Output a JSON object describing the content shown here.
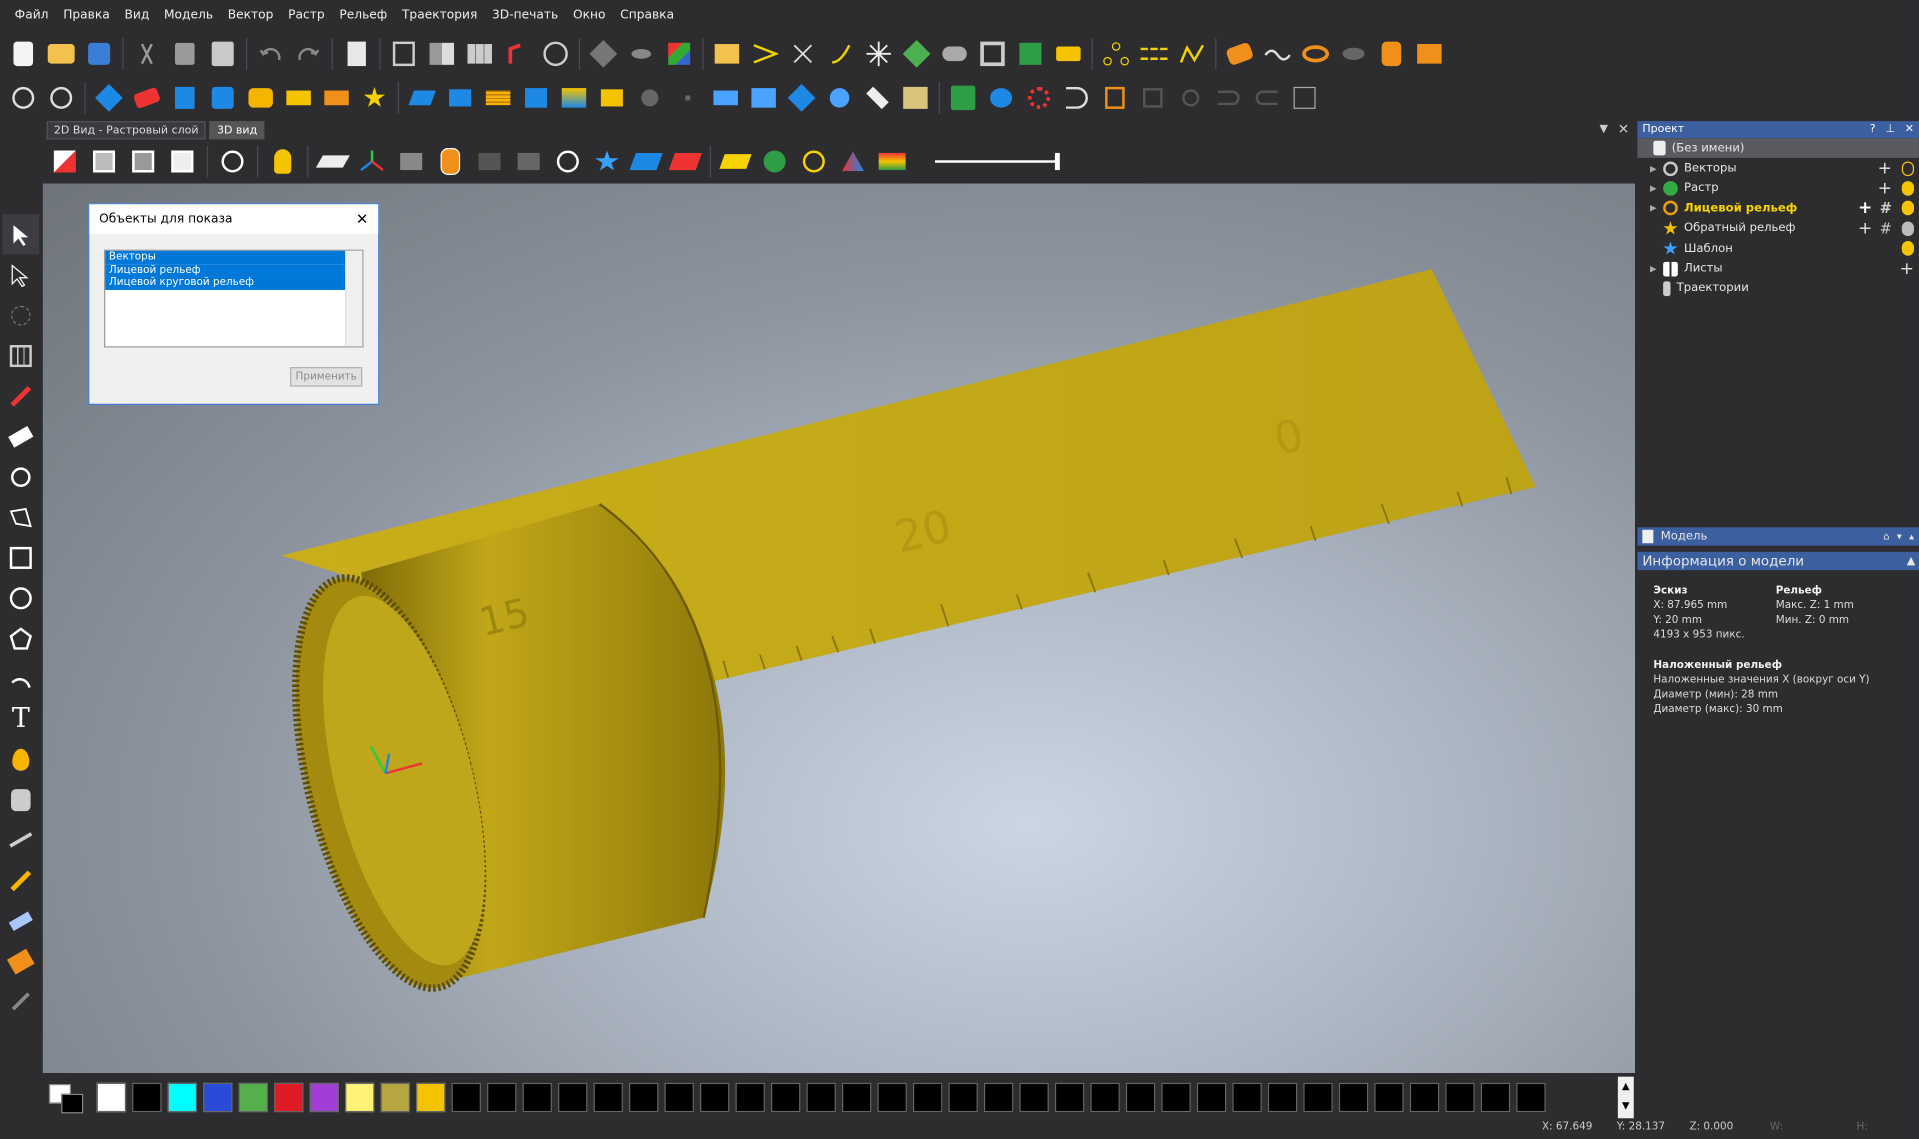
{
  "menu": [
    "Файл",
    "Правка",
    "Вид",
    "Модель",
    "Вектор",
    "Растр",
    "Рельеф",
    "Траектория",
    "3D-печать",
    "Окно",
    "Справка"
  ],
  "tabs": {
    "view2d": "2D Вид - Растровый слой",
    "view3d": "3D вид"
  },
  "dialog": {
    "title": "Объекты для показа",
    "items": [
      "Векторы",
      "Лицевой рельеф",
      "Лицевой круговой рельеф"
    ],
    "apply": "Применить"
  },
  "project": {
    "title": "Проект",
    "root": "(Без имени)",
    "items": [
      {
        "label": "Векторы",
        "color": "#c8c8c8"
      },
      {
        "label": "Растр",
        "color": "#33aa44"
      },
      {
        "label": "Лицевой рельеф",
        "color": "#f0a000",
        "active": true
      },
      {
        "label": "Обратный рельеф",
        "color": "#f0c000"
      },
      {
        "label": "Шаблон",
        "color": "#3aa0ff"
      },
      {
        "label": "Листы",
        "color": "#ffffff"
      },
      {
        "label": "Траектории",
        "color": "#cccccc"
      }
    ]
  },
  "model": {
    "title": "Модель",
    "info_title": "Информация о модели",
    "sketch_h": "Эскиз",
    "sketch_x": "X: 87.965 mm",
    "sketch_y": "Y: 20 mm",
    "sketch_px": "4193 x 953 пикс.",
    "relief_h": "Рельеф",
    "relief_max": "Макс. Z: 1 mm",
    "relief_min": "Мин. Z: 0 mm",
    "wrap_h": "Наложенный рельеф",
    "wrap_1": "Наложенные значения X (вокруг оси Y)",
    "wrap_2": "Диаметр (мин): 28 mm",
    "wrap_3": "Диаметр (макс): 30 mm"
  },
  "ruler": {
    "label_0": "0",
    "label_20": "20",
    "label_15": "15"
  },
  "status": {
    "x": "X: 67.649",
    "y": "Y: 28.137",
    "z": "Z: 0.000",
    "w": "W:",
    "h": "H:"
  },
  "palette": [
    "#ffffff",
    "#000000",
    "#00ffff",
    "#2a4bd7",
    "#55b04b",
    "#e01b24",
    "#a23ed6",
    "#fff176",
    "#b5a642",
    "#f5c400",
    "#000000",
    "#000000",
    "#000000",
    "#000000",
    "#000000",
    "#000000",
    "#000000",
    "#000000",
    "#000000",
    "#000000",
    "#000000",
    "#000000",
    "#000000",
    "#000000",
    "#000000",
    "#000000",
    "#000000",
    "#000000",
    "#000000",
    "#000000",
    "#000000",
    "#000000",
    "#000000",
    "#000000",
    "#000000",
    "#000000",
    "#000000",
    "#000000",
    "#000000",
    "#000000",
    "#000000"
  ]
}
